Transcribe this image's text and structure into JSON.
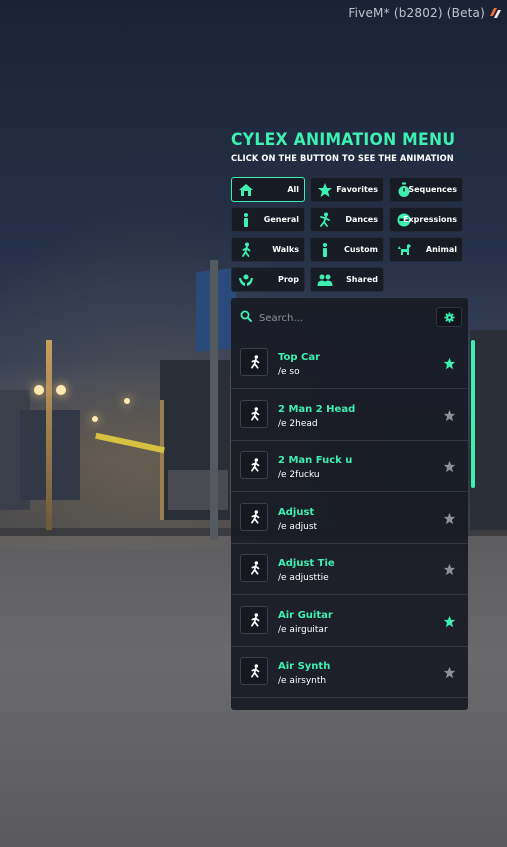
{
  "window": {
    "title": "FiveM* (b2802) (Beta)"
  },
  "menu": {
    "title": "CYLEX ANIMATION MENU",
    "subtitle": "CLICK ON THE BUTTON TO SEE THE ANIMATION",
    "accent_color": "#3ef0b0",
    "categories": [
      {
        "label": "All",
        "icon": "home-icon",
        "active": true
      },
      {
        "label": "Favorites",
        "icon": "star-icon",
        "active": false
      },
      {
        "label": "Sequences",
        "icon": "stopwatch-icon",
        "active": false
      },
      {
        "label": "General",
        "icon": "person-icon",
        "active": false
      },
      {
        "label": "Dances",
        "icon": "dancer-icon",
        "active": false
      },
      {
        "label": "Expressions",
        "icon": "face-icon",
        "active": false
      },
      {
        "label": "Walks",
        "icon": "walking-icon",
        "active": false
      },
      {
        "label": "Custom",
        "icon": "person-icon",
        "active": false
      },
      {
        "label": "Animal",
        "icon": "dog-icon",
        "active": false
      },
      {
        "label": "Prop",
        "icon": "hands-icon",
        "active": false
      },
      {
        "label": "Shared",
        "icon": "people-icon",
        "active": false
      }
    ],
    "search": {
      "placeholder": "Search..."
    },
    "settings_icon": "gear-icon",
    "animations": [
      {
        "name": "Top Car",
        "command": "/e so",
        "favorite": true
      },
      {
        "name": "2 Man 2 Head",
        "command": "/e 2head",
        "favorite": false
      },
      {
        "name": "2 Man Fuck u",
        "command": "/e 2fucku",
        "favorite": false
      },
      {
        "name": "Adjust",
        "command": "/e adjust",
        "favorite": false
      },
      {
        "name": "Adjust Tie",
        "command": "/e adjusttie",
        "favorite": false
      },
      {
        "name": "Air Guitar",
        "command": "/e airguitar",
        "favorite": true
      },
      {
        "name": "Air Synth",
        "command": "/e airsynth",
        "favorite": false
      }
    ],
    "scroll_position_fraction": 0.0,
    "scroll_visible_fraction": 0.4
  }
}
